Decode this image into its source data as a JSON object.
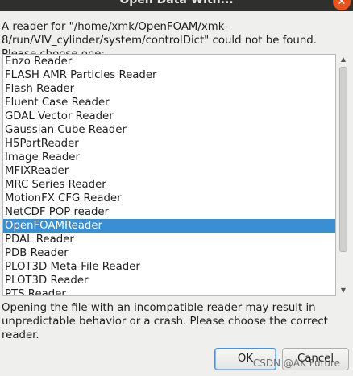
{
  "window": {
    "title": "Open Data With..."
  },
  "prompt": "A reader for \"/home/xmk/OpenFOAM/xmk-8/run/VIV_cylinder/system/controlDict\" could not be found. Please choose one:",
  "readers": {
    "items": [
      "Enzo Reader",
      "FLASH AMR Particles Reader",
      "Flash Reader",
      "Fluent Case Reader",
      "GDAL Vector Reader",
      "Gaussian Cube Reader",
      "H5PartReader",
      "Image Reader",
      "MFIXReader",
      "MRC Series Reader",
      "MotionFX CFG Reader",
      "NetCDF POP reader",
      "OpenFOAMReader",
      "PDAL Reader",
      "PDB Reader",
      "PLOT3D Meta-File Reader",
      "PLOT3D Reader",
      "PTS Reader"
    ],
    "selected": "OpenFOAMReader"
  },
  "warning": "Opening the file with an incompatible reader may result in unpredictable behavior or a crash.  Please choose the correct reader.",
  "buttons": {
    "ok": "OK",
    "cancel": "Cancel"
  },
  "watermark": "CSDN @AK Future",
  "colors": {
    "selection": "#3a8fd4",
    "titlebar": "#2f2f2e",
    "close": "#e9531c"
  }
}
